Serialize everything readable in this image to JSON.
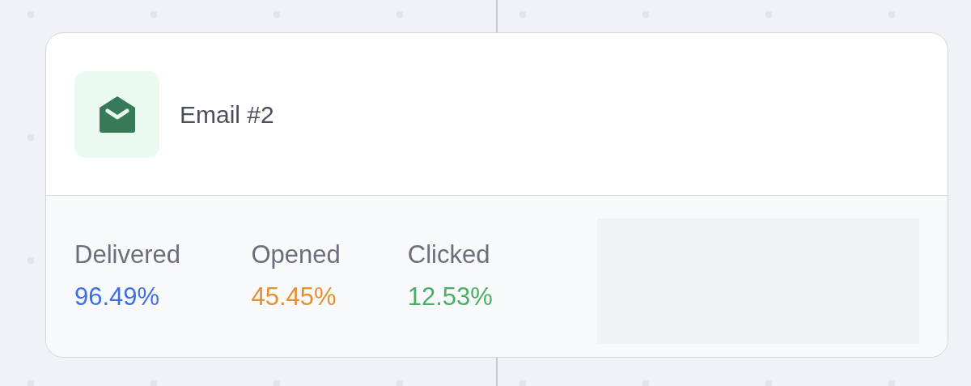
{
  "card": {
    "title": "Email #2",
    "stats": [
      {
        "label": "Delivered",
        "value": "96.49%",
        "color": "#3d6fe6"
      },
      {
        "label": "Opened",
        "value": "45.45%",
        "color": "#e48f30"
      },
      {
        "label": "Clicked",
        "value": "12.53%",
        "color": "#4bae65"
      }
    ]
  }
}
